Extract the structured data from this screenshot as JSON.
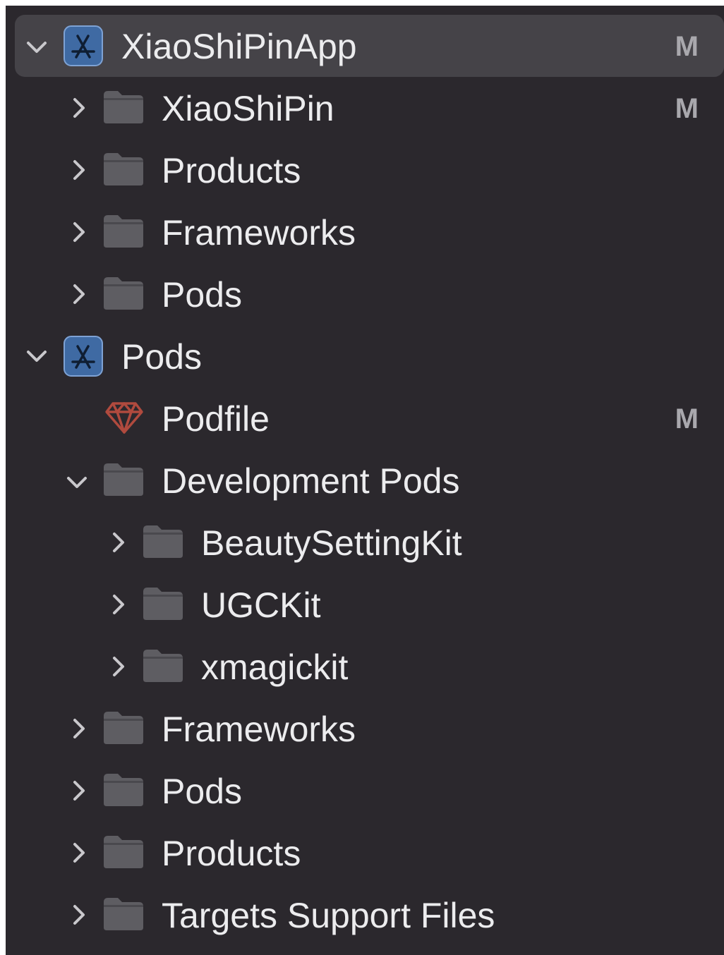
{
  "navigator": {
    "items": [
      {
        "label": "XiaoShiPinApp",
        "badge": "M",
        "kind": "project",
        "expanded": true,
        "selected": true,
        "icon": "app-project-icon"
      },
      {
        "label": "XiaoShiPin",
        "badge": "M",
        "kind": "group",
        "expanded": false,
        "icon": "folder-icon"
      },
      {
        "label": "Products",
        "badge": "",
        "kind": "group",
        "expanded": false,
        "icon": "folder-icon"
      },
      {
        "label": "Frameworks",
        "badge": "",
        "kind": "group",
        "expanded": false,
        "icon": "folder-icon"
      },
      {
        "label": "Pods",
        "badge": "",
        "kind": "group",
        "expanded": false,
        "icon": "folder-icon"
      },
      {
        "label": "Pods",
        "badge": "",
        "kind": "project",
        "expanded": true,
        "icon": "app-project-icon"
      },
      {
        "label": "Podfile",
        "badge": "M",
        "kind": "file",
        "icon": "ruby-gem-icon"
      },
      {
        "label": "Development Pods",
        "badge": "",
        "kind": "group",
        "expanded": true,
        "icon": "folder-icon"
      },
      {
        "label": "BeautySettingKit",
        "badge": "",
        "kind": "group",
        "expanded": false,
        "icon": "folder-icon"
      },
      {
        "label": "UGCKit",
        "badge": "",
        "kind": "group",
        "expanded": false,
        "icon": "folder-icon"
      },
      {
        "label": "xmagickit",
        "badge": "",
        "kind": "group",
        "expanded": false,
        "icon": "folder-icon"
      },
      {
        "label": "Frameworks",
        "badge": "",
        "kind": "group",
        "expanded": false,
        "icon": "folder-icon"
      },
      {
        "label": "Pods",
        "badge": "",
        "kind": "group",
        "expanded": false,
        "icon": "folder-icon"
      },
      {
        "label": "Products",
        "badge": "",
        "kind": "group",
        "expanded": false,
        "icon": "folder-icon"
      },
      {
        "label": "Targets Support Files",
        "badge": "",
        "kind": "group",
        "expanded": false,
        "icon": "folder-icon"
      }
    ]
  },
  "colors": {
    "background": "#2b282d",
    "selection": "#454348",
    "text": "#ececee",
    "badge": "#a9a8ad",
    "folder": "#5e5d62",
    "project_icon": "#3f6aa3",
    "gem": "#b04a3e"
  }
}
